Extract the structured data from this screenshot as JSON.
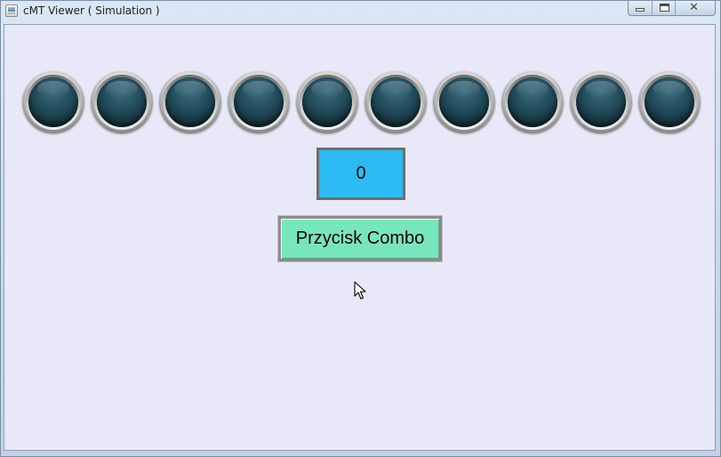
{
  "window": {
    "title": "cMT Viewer ( Simulation )",
    "app_icon": "hmi-app-icon",
    "buttons": {
      "minimize_icon": "minimize-icon",
      "maximize_icon": "maximize-icon",
      "close_icon": "close-icon",
      "close_glyph": "✕"
    }
  },
  "screen": {
    "background_color": "#e8e8f8",
    "lamps": [
      {
        "state": "off"
      },
      {
        "state": "off"
      },
      {
        "state": "off"
      },
      {
        "state": "off"
      },
      {
        "state": "off"
      },
      {
        "state": "off"
      },
      {
        "state": "off"
      },
      {
        "state": "off"
      },
      {
        "state": "off"
      },
      {
        "state": "off"
      }
    ],
    "numeric_display": {
      "value": "0",
      "color": "#2cbbf3"
    },
    "combo_button": {
      "label": "Przycisk Combo",
      "color": "#78e6bc"
    },
    "cursor_icon": "mouse-pointer-icon"
  }
}
